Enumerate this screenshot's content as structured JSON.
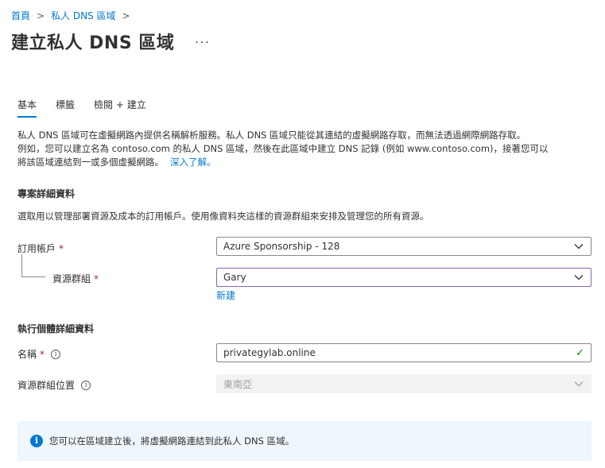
{
  "breadcrumb": {
    "home": "首頁",
    "parent": "私人 DNS 區域",
    "sep1": ">",
    "sep2": ">"
  },
  "page": {
    "title": "建立私人 DNS 區域",
    "more": "···"
  },
  "tabs": [
    {
      "label": "基本",
      "active": true
    },
    {
      "label": "標籤",
      "active": false
    },
    {
      "label": "檢閱 + 建立",
      "active": false
    }
  ],
  "intro": {
    "line1": "私人 DNS 區域可在虛擬網路內提供名稱解析服務。私人 DNS 區域只能從其連結的虛擬網路存取，而無法透過網際網路存取。",
    "line2": "例如，您可以建立名為 contoso.com 的私人 DNS 區域，然後在此區域中建立 DNS 記錄 (例如 www.contoso.com)，接著您可以",
    "line3": "將該區域連結到一或多個虛擬網路。",
    "learn_more": "深入了解。"
  },
  "project": {
    "title": "專案詳細資料",
    "desc": "選取用以管理部署資源及成本的訂用帳戶。使用像資料夾這樣的資源群組來安排及管理您的所有資源。",
    "subscription_label": "訂用帳戶",
    "subscription_value": "Azure Sponsorship - 128",
    "resource_group_label": "資源群組",
    "resource_group_value": "Gary",
    "create_new": "新建",
    "required_mark": "*"
  },
  "instance": {
    "title": "執行個體詳細資料",
    "name_label": "名稱",
    "name_value": "privategylab.online",
    "location_label": "資源群組位置",
    "location_value": "東南亞",
    "info_glyph": "i",
    "check_glyph": "✓"
  },
  "banner": {
    "text": "您可以在區域建立後，將虛擬網路連結到此私人 DNS 區域。",
    "icon_glyph": "i"
  },
  "colors": {
    "accent": "#0078d4",
    "required": "#a4262c",
    "success": "#107c10",
    "banner_bg": "#eff6fc",
    "focus_border": "#8764b8"
  }
}
